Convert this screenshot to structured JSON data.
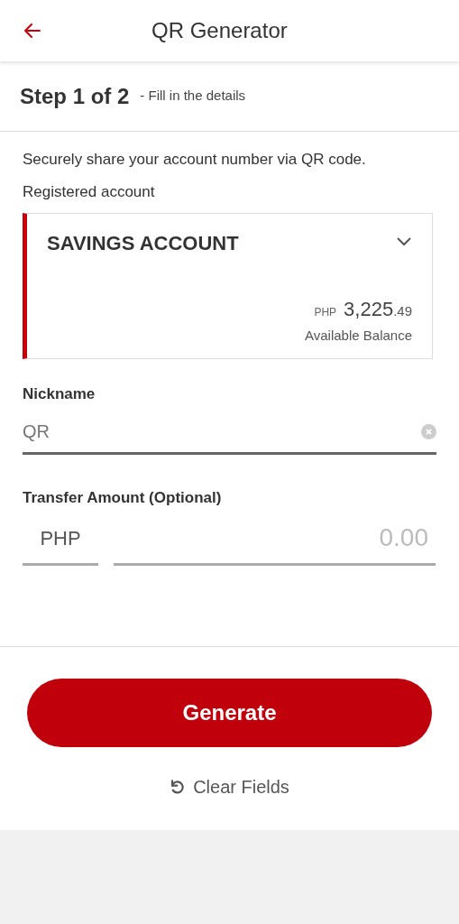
{
  "header": {
    "title": "QR Generator"
  },
  "step": {
    "title": "Step 1 of 2",
    "subtitle": "- Fill in the details"
  },
  "intro": "Securely share your account number via QR code.",
  "account": {
    "label": "Registered account",
    "name": "SAVINGS ACCOUNT",
    "currency": "PHP",
    "amount_whole": "3,225",
    "amount_decimal": ".49",
    "caption": "Available Balance"
  },
  "nickname": {
    "label": "Nickname",
    "value": "QR"
  },
  "amount": {
    "label": "Transfer Amount (Optional)",
    "currency": "PHP",
    "placeholder": "0.00"
  },
  "buttons": {
    "primary": "Generate",
    "secondary": "Clear Fields"
  }
}
